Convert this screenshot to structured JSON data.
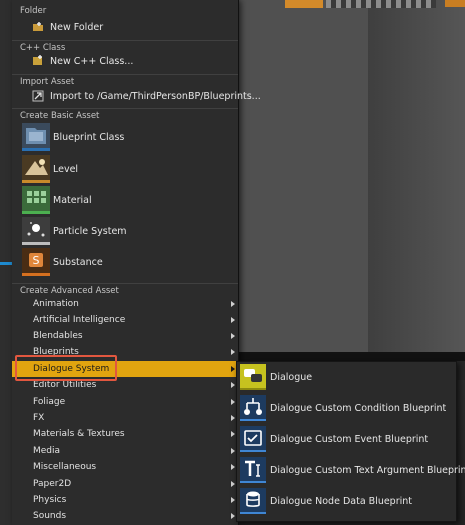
{
  "menu": {
    "sections": {
      "folder": "Folder",
      "cpp": "C++ Class",
      "import": "Import Asset",
      "basic": "Create Basic Asset",
      "advanced": "Create Advanced Asset"
    },
    "new_folder": "New Folder",
    "new_cpp_class": "New C++ Class...",
    "import_to": "Import to /Game/ThirdPersonBP/Blueprints...",
    "basic_assets": [
      {
        "label": "Blueprint Class",
        "icon": "blueprint-icon",
        "color": "#2a6fb0"
      },
      {
        "label": "Level",
        "icon": "level-icon",
        "color": "#8a6a2f"
      },
      {
        "label": "Material",
        "icon": "material-icon",
        "color": "#3f9a3f"
      },
      {
        "label": "Particle System",
        "icon": "particle-icon",
        "color": "#b0b0b0"
      },
      {
        "label": "Substance",
        "icon": "substance-icon",
        "color": "#d6701f"
      }
    ],
    "advanced": [
      "Animation",
      "Artificial Intelligence",
      "Blendables",
      "Blueprints",
      "Dialogue System",
      "Editor Utilities",
      "Foliage",
      "FX",
      "Materials & Textures",
      "Media",
      "Miscellaneous",
      "Paper2D",
      "Physics",
      "Sounds"
    ],
    "active_index": 4
  },
  "submenu": {
    "items": [
      {
        "label": "Dialogue",
        "icon": "dialogue-icon"
      },
      {
        "label": "Dialogue Custom Condition Blueprint",
        "icon": "condition-icon"
      },
      {
        "label": "Dialogue Custom Event Blueprint",
        "icon": "event-icon"
      },
      {
        "label": "Dialogue Custom Text Argument Blueprint",
        "icon": "text-argument-icon"
      },
      {
        "label": "Dialogue Node Data Blueprint",
        "icon": "node-data-icon"
      }
    ]
  },
  "colors": {
    "active": "#e1a40f",
    "highlight": "#e2573f",
    "accent_blue": "#2a6fb0"
  }
}
